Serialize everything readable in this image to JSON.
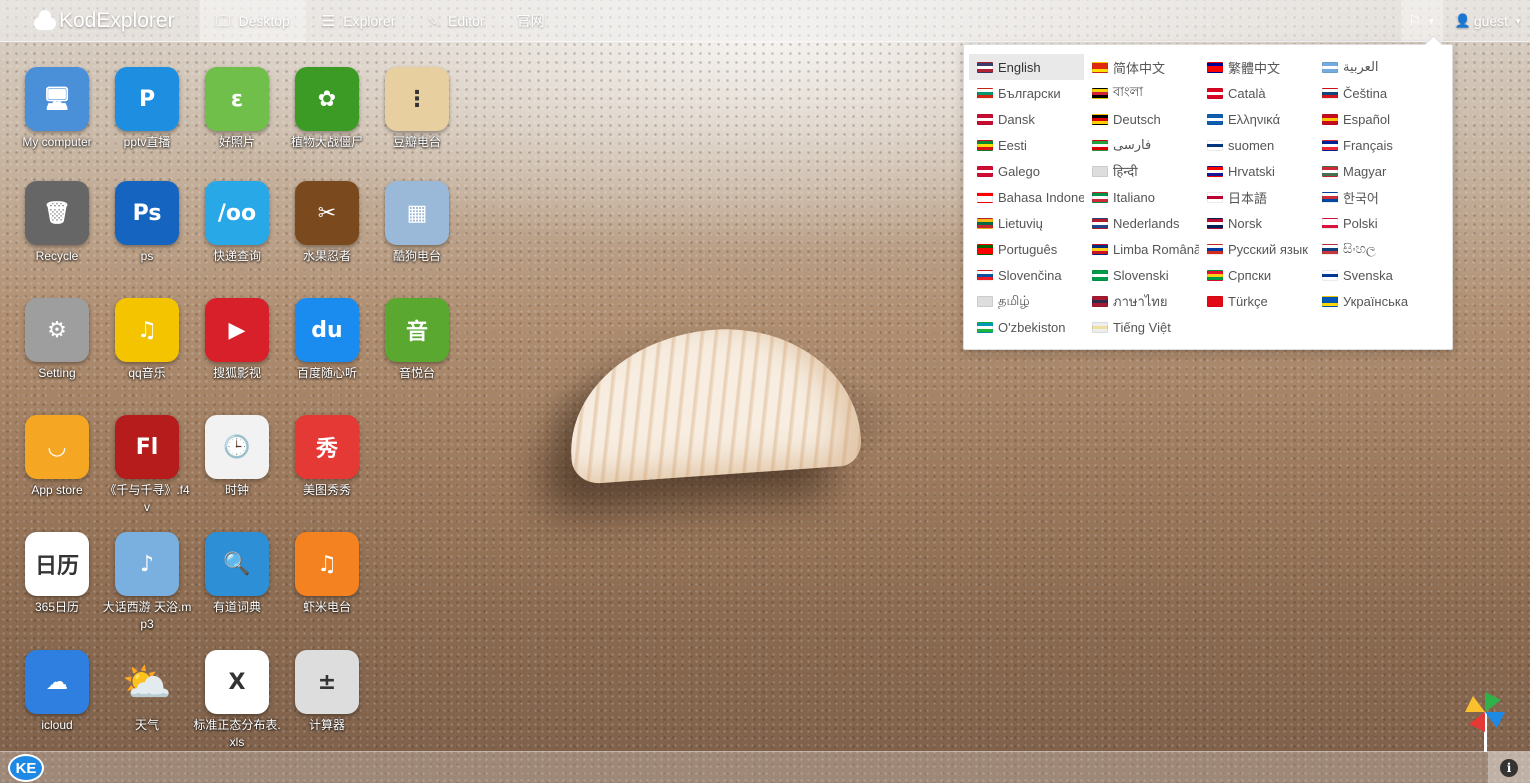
{
  "brand": "KodExplorer",
  "nav": [
    {
      "label": "Desktop",
      "icon": "desktop-icon",
      "glyph": "🖵",
      "active": true
    },
    {
      "label": "Explorer",
      "icon": "list-icon",
      "glyph": "☰",
      "active": false
    },
    {
      "label": "Editor",
      "icon": "edit-icon",
      "glyph": "✎",
      "active": false
    },
    {
      "label": "官网",
      "icon": "",
      "glyph": "",
      "active": false
    }
  ],
  "user": {
    "name": "guest"
  },
  "languages": [
    {
      "label": "English",
      "flag": [
        "#3c3b6e",
        "#ffffff",
        "#b22234"
      ],
      "selected": true
    },
    {
      "label": "简体中文",
      "flag": [
        "#de2910",
        "#de2910",
        "#ffde00"
      ]
    },
    {
      "label": "繁體中文",
      "flag": [
        "#000095",
        "#fe0000",
        "#fe0000"
      ]
    },
    {
      "label": "العربية",
      "flag": [
        "#74acdf",
        "#ffffff",
        "#74acdf"
      ]
    },
    {
      "label": "Български",
      "flag": [
        "#ffffff",
        "#00966e",
        "#d62612"
      ]
    },
    {
      "label": "বাংলা",
      "flag": [
        "#f4d400",
        "#d41f3a",
        "#000000"
      ]
    },
    {
      "label": "Català",
      "flag": [
        "#d80621",
        "#ffffff",
        "#d80621"
      ]
    },
    {
      "label": "Čeština",
      "flag": [
        "#ffffff",
        "#11457e",
        "#d7141a"
      ]
    },
    {
      "label": "Dansk",
      "flag": [
        "#c60c30",
        "#ffffff",
        "#c60c30"
      ]
    },
    {
      "label": "Deutsch",
      "flag": [
        "#000000",
        "#dd0000",
        "#ffce00"
      ]
    },
    {
      "label": "Ελληνικά",
      "flag": [
        "#0d5eaf",
        "#ffffff",
        "#0d5eaf"
      ]
    },
    {
      "label": "Español",
      "flag": [
        "#c60b1e",
        "#ffc400",
        "#c60b1e"
      ]
    },
    {
      "label": "Eesti",
      "flag": [
        "#078930",
        "#fcdd09",
        "#da121a"
      ]
    },
    {
      "label": "فارسی",
      "flag": [
        "#239f40",
        "#ffffff",
        "#da0000"
      ]
    },
    {
      "label": "suomen",
      "flag": [
        "#ffffff",
        "#003580",
        "#ffffff"
      ]
    },
    {
      "label": "Français",
      "flag": [
        "#002395",
        "#ffffff",
        "#ed2939"
      ]
    },
    {
      "label": "Galego",
      "flag": [
        "#d00c33",
        "#ffffff",
        "#d00c33"
      ]
    },
    {
      "label": "हिन्दी",
      "flag": [
        "#dddddd",
        "#dddddd",
        "#dddddd"
      ]
    },
    {
      "label": "Hrvatski",
      "flag": [
        "#ff0000",
        "#ffffff",
        "#171796"
      ]
    },
    {
      "label": "Magyar",
      "flag": [
        "#ce2939",
        "#ffffff",
        "#477050"
      ]
    },
    {
      "label": "Bahasa Indone",
      "flag": [
        "#ff0000",
        "#ffffff",
        "#ffffff"
      ]
    },
    {
      "label": "Italiano",
      "flag": [
        "#009246",
        "#ffffff",
        "#ce2b37"
      ]
    },
    {
      "label": "日本語",
      "flag": [
        "#ffffff",
        "#bc002d",
        "#ffffff"
      ]
    },
    {
      "label": "한국어",
      "flag": [
        "#ffffff",
        "#cd2e3a",
        "#0047a0"
      ]
    },
    {
      "label": "Lietuvių",
      "flag": [
        "#fdb913",
        "#006a44",
        "#c1272d"
      ]
    },
    {
      "label": "Nederlands",
      "flag": [
        "#ae1c28",
        "#ffffff",
        "#21468b"
      ]
    },
    {
      "label": "Norsk",
      "flag": [
        "#ba0c2f",
        "#ffffff",
        "#00205b"
      ]
    },
    {
      "label": "Polski",
      "flag": [
        "#ffffff",
        "#ffffff",
        "#dc143c"
      ]
    },
    {
      "label": "Português",
      "flag": [
        "#006600",
        "#ff0000",
        "#ff0000"
      ]
    },
    {
      "label": "Limba Română",
      "flag": [
        "#002b7f",
        "#fcd116",
        "#ce1126"
      ]
    },
    {
      "label": "Русский язык",
      "flag": [
        "#ffffff",
        "#0039a6",
        "#d52b1e"
      ]
    },
    {
      "label": "සිංහල",
      "flag": [
        "#ffffff",
        "#0c4076",
        "#c6363c"
      ]
    },
    {
      "label": "Slovenčina",
      "flag": [
        "#ffffff",
        "#0b4ea2",
        "#ee1c25"
      ]
    },
    {
      "label": "Slovenski",
      "flag": [
        "#009a49",
        "#ffffff",
        "#009a49"
      ]
    },
    {
      "label": "Српски",
      "flag": [
        "#e8112d",
        "#fcd116",
        "#009a44"
      ]
    },
    {
      "label": "Svenska",
      "flag": [
        "#ffffff",
        "#003893",
        "#ffffff"
      ]
    },
    {
      "label": "தமிழ்",
      "flag": [
        "#dddddd",
        "#dddddd",
        "#dddddd"
      ]
    },
    {
      "label": "ภาษาไทย",
      "flag": [
        "#a51931",
        "#2d2a4a",
        "#a51931"
      ]
    },
    {
      "label": "Türkçe",
      "flag": [
        "#e30a17",
        "#e30a17",
        "#e30a17"
      ]
    },
    {
      "label": "Українська",
      "flag": [
        "#0057b7",
        "#0057b7",
        "#ffd700"
      ]
    },
    {
      "label": "O'zbekiston",
      "flag": [
        "#0099b5",
        "#ffffff",
        "#1eb53a"
      ]
    },
    {
      "label": "Tiếng Việt",
      "flag": [
        "#eeeeee",
        "#f0e0a0",
        "#eeeeee"
      ]
    }
  ],
  "desktop_icons": [
    {
      "label": "My computer",
      "icon": "computer-icon",
      "bg": "#4a90d9",
      "glyph": "🖥"
    },
    {
      "label": "pptv直播",
      "icon": "pptv-icon",
      "bg": "#1e8fe0",
      "glyph": "P"
    },
    {
      "label": "好照片",
      "icon": "chameleon-icon",
      "bg": "#6fbf4a",
      "glyph": "ε"
    },
    {
      "label": "植物大战僵尸",
      "icon": "plants-zombies-icon",
      "bg": "#3b9b24",
      "glyph": "✿"
    },
    {
      "label": "豆瓣电台",
      "icon": "radio-icon",
      "bg": "#e8cfa0",
      "glyph": "⋮"
    },
    {
      "label": "Recycle",
      "icon": "trash-icon",
      "bg": "#666666",
      "glyph": "🗑"
    },
    {
      "label": "ps",
      "icon": "photoshop-icon",
      "bg": "#1565c0",
      "glyph": "Ps"
    },
    {
      "label": "快递查询",
      "icon": "express-icon",
      "bg": "#29a8e8",
      "glyph": "/oo"
    },
    {
      "label": "水果忍者",
      "icon": "fruit-ninja-icon",
      "bg": "#7a4a1e",
      "glyph": "✂"
    },
    {
      "label": "酷狗电台",
      "icon": "radio-blue-icon",
      "bg": "#9ab8d8",
      "glyph": "▦"
    },
    {
      "label": "Setting",
      "icon": "gear-icon",
      "bg": "#9e9e9e",
      "glyph": "⚙"
    },
    {
      "label": "qq音乐",
      "icon": "qq-music-icon",
      "bg": "#f5c400",
      "glyph": "♫"
    },
    {
      "label": "搜狐影视",
      "icon": "sohu-video-icon",
      "bg": "#d8202a",
      "glyph": "▶"
    },
    {
      "label": "百度随心听",
      "icon": "baidu-music-icon",
      "bg": "#1a8cf0",
      "glyph": "du"
    },
    {
      "label": "音悦台",
      "icon": "yinyuetai-icon",
      "bg": "#5aa830",
      "glyph": "音"
    },
    {
      "label": "App store",
      "icon": "app-store-icon",
      "bg": "#f5a623",
      "glyph": "◡"
    },
    {
      "label": "《千与千寻》.f4v",
      "icon": "flv-file-icon",
      "bg": "#b71c1c",
      "glyph": "Fl"
    },
    {
      "label": "时钟",
      "icon": "clock-icon",
      "bg": "#f2f2f2",
      "glyph": "🕒"
    },
    {
      "label": "美图秀秀",
      "icon": "meitu-icon",
      "bg": "#e53935",
      "glyph": "秀"
    },
    {
      "label": "365日历",
      "icon": "calendar-icon",
      "bg": "#ffffff",
      "glyph": "日历"
    },
    {
      "label": "大话西游 天浴.mp3",
      "icon": "music-file-icon",
      "bg": "#7ab0e0",
      "glyph": "♪"
    },
    {
      "label": "有道词典",
      "icon": "dictionary-icon",
      "bg": "#2d8fd5",
      "glyph": "🔍"
    },
    {
      "label": "虾米电台",
      "icon": "xiami-icon",
      "bg": "#f58220",
      "glyph": "♫"
    },
    {
      "label": "icloud",
      "icon": "icloud-icon",
      "bg": "#2f7fe0",
      "glyph": "☁"
    },
    {
      "label": "天气",
      "icon": "weather-icon",
      "bg": "transparent",
      "glyph": "⛅"
    },
    {
      "label": "标准正态分布表.xls",
      "icon": "excel-file-icon",
      "bg": "#ffffff",
      "glyph": "X"
    },
    {
      "label": "计算器",
      "icon": "calculator-icon",
      "bg": "#dddddd",
      "glyph": "±"
    }
  ],
  "taskbar": {
    "start": "KE",
    "info": "i"
  }
}
